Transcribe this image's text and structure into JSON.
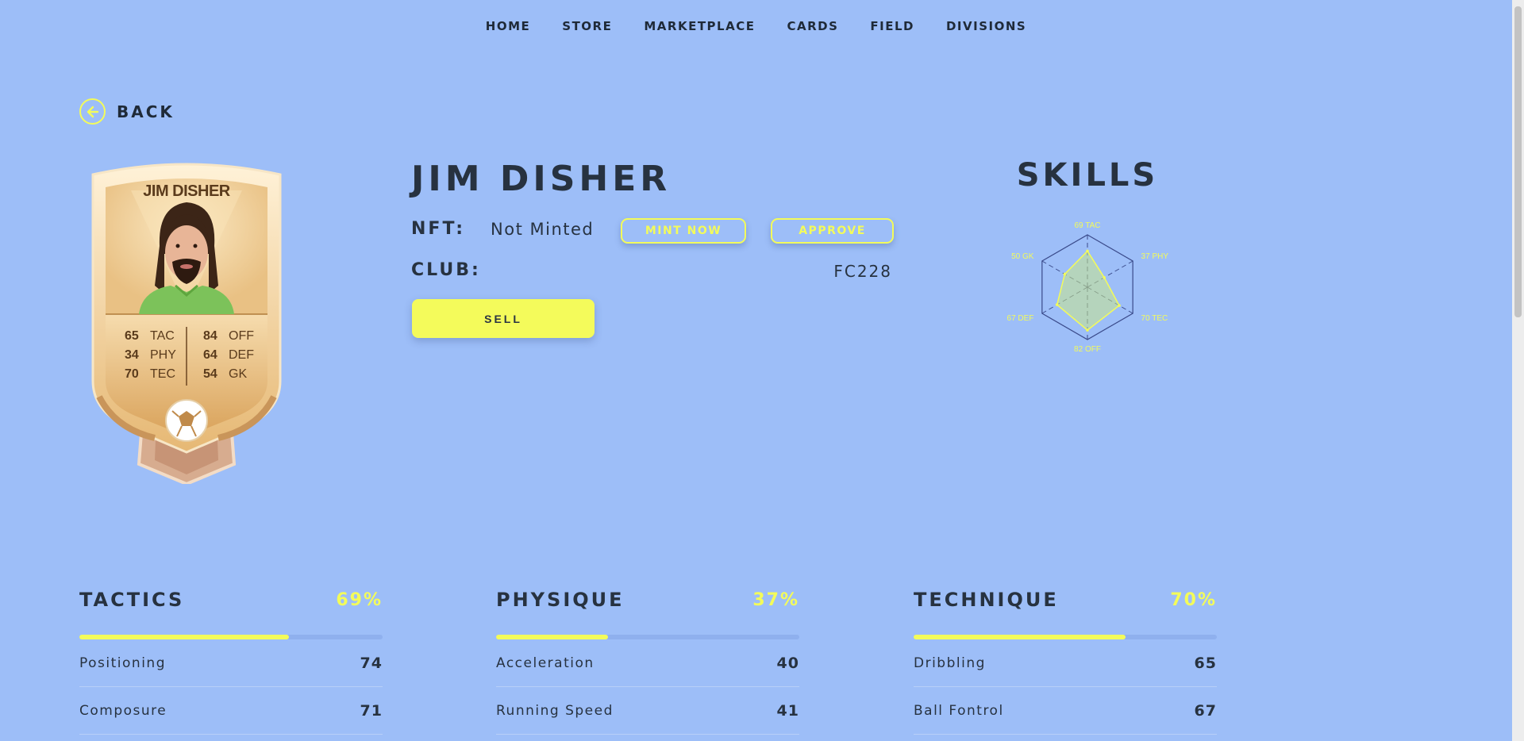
{
  "nav": {
    "items": [
      "HOME",
      "STORE",
      "MARKETPLACE",
      "CARDS",
      "FIELD",
      "DIVISIONS"
    ]
  },
  "back": {
    "label": "BACK",
    "icon": "arrow-left-circle-icon"
  },
  "card": {
    "name": "JIM DISHER",
    "stats": [
      {
        "left_value": "65",
        "left_label": "TAC",
        "right_value": "84",
        "right_label": "OFF"
      },
      {
        "left_value": "34",
        "left_label": "PHY",
        "right_value": "64",
        "right_label": "DEF"
      },
      {
        "left_value": "70",
        "left_label": "TEC",
        "right_value": "54",
        "right_label": "GK"
      }
    ]
  },
  "player": {
    "name": "JIM DISHER",
    "nft_label": "NFT:",
    "nft_value": "Not Minted",
    "mint_button": "MINT NOW",
    "approve_button": "APPROVE",
    "club_label": "CLUB:",
    "club_value": "FC228",
    "sell_button": "SELL"
  },
  "skills": {
    "title": "SKILLS",
    "radar": [
      {
        "label": "69 TAC",
        "value": 69
      },
      {
        "label": "37 PHY",
        "value": 37
      },
      {
        "label": "70 TEC",
        "value": 70
      },
      {
        "label": "82 OFF",
        "value": 82
      },
      {
        "label": "67 DEF",
        "value": 67
      },
      {
        "label": "50 GK",
        "value": 50
      }
    ],
    "max": 100
  },
  "sections": [
    {
      "title": "TACTICS",
      "percent_label": "69%",
      "percent": 69,
      "rows": [
        {
          "label": "Positioning",
          "value": "74"
        },
        {
          "label": "Composure",
          "value": "71"
        }
      ]
    },
    {
      "title": "PHYSIQUE",
      "percent_label": "37%",
      "percent": 37,
      "rows": [
        {
          "label": "Acceleration",
          "value": "40"
        },
        {
          "label": "Running Speed",
          "value": "41"
        }
      ]
    },
    {
      "title": "TECHNIQUE",
      "percent_label": "70%",
      "percent": 70,
      "rows": [
        {
          "label": "Dribbling",
          "value": "65"
        },
        {
          "label": "Ball Fontrol",
          "value": "67"
        }
      ]
    }
  ],
  "colors": {
    "background": "#9dbef8",
    "accent": "#f3fb5a",
    "text": "#273240"
  }
}
